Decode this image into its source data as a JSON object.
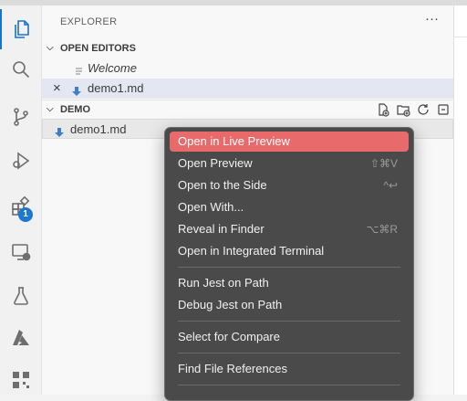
{
  "activity_bar": {
    "items": [
      {
        "icon": "files-icon",
        "active": true
      },
      {
        "icon": "search-icon"
      },
      {
        "icon": "source-control-icon"
      },
      {
        "icon": "run-debug-icon"
      },
      {
        "icon": "extensions-icon",
        "badge": "1"
      },
      {
        "icon": "remote-explorer-icon"
      },
      {
        "icon": "testing-flask-icon"
      },
      {
        "icon": "azure-icon"
      },
      {
        "icon": "qr-code-icon"
      }
    ]
  },
  "sidebar": {
    "title": "EXPLORER",
    "more": "···",
    "open_editors": {
      "heading": "OPEN EDITORS",
      "items": [
        {
          "name": "Welcome"
        },
        {
          "name": "demo1.md",
          "close": "×"
        }
      ]
    },
    "demo": {
      "heading": "DEMO",
      "items": [
        {
          "name": "demo1.md"
        }
      ]
    }
  },
  "context_menu": {
    "items": [
      {
        "label": "Open in Live Preview",
        "shortcut": ""
      },
      {
        "label": "Open Preview",
        "shortcut": "⇧⌘V"
      },
      {
        "label": "Open to the Side",
        "shortcut": "^↩"
      },
      {
        "label": "Open With...",
        "shortcut": ""
      },
      {
        "label": "Reveal in Finder",
        "shortcut": "⌥⌘R"
      },
      {
        "label": "Open in Integrated Terminal",
        "shortcut": ""
      },
      {
        "label": "Run Jest on Path",
        "shortcut": ""
      },
      {
        "label": "Debug Jest on Path",
        "shortcut": ""
      },
      {
        "label": "Select for Compare",
        "shortcut": ""
      },
      {
        "label": "Find File References",
        "shortcut": ""
      }
    ]
  },
  "colors": {
    "menu_bg": "#4a4a4a",
    "menu_highlight": "#e96a6a",
    "accent": "#1a73c7",
    "markdown_icon": "#3f7fc7"
  }
}
